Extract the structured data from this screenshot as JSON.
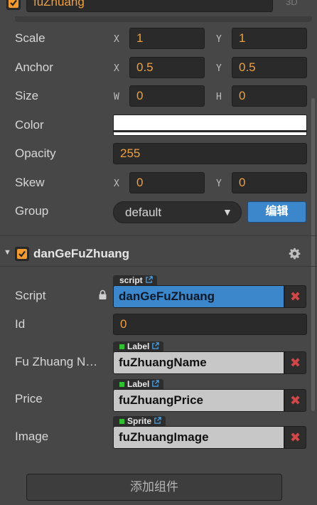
{
  "node": {
    "name": "fuZhuang",
    "badge_3d": "3D"
  },
  "props": {
    "scale": {
      "label": "Scale",
      "axis1": "X",
      "val1": "1",
      "axis2": "Y",
      "val2": "1"
    },
    "anchor": {
      "label": "Anchor",
      "axis1": "X",
      "val1": "0.5",
      "axis2": "Y",
      "val2": "0.5"
    },
    "size": {
      "label": "Size",
      "axis1": "W",
      "val1": "0",
      "axis2": "H",
      "val2": "0"
    },
    "color": {
      "label": "Color",
      "value": "#ffffff"
    },
    "opacity": {
      "label": "Opacity",
      "value": "255"
    },
    "skew": {
      "label": "Skew",
      "axis1": "X",
      "val1": "0",
      "axis2": "Y",
      "val2": "0"
    },
    "group": {
      "label": "Group",
      "value": "default",
      "edit_label": "编辑"
    }
  },
  "component": {
    "title": "danGeFuZhuang",
    "script": {
      "label": "Script",
      "tag": "script",
      "value": "danGeFuZhuang"
    },
    "id": {
      "label": "Id",
      "value": "0"
    },
    "fields": [
      {
        "label": "Fu Zhuang N…",
        "tag": "Label",
        "value": "fuZhuangName"
      },
      {
        "label": "Price",
        "tag": "Label",
        "value": "fuZhuangPrice"
      },
      {
        "label": "Image",
        "tag": "Sprite",
        "value": "fuZhuangImage"
      }
    ]
  },
  "add_component_label": "添加组件",
  "colors": {
    "background": "#474747",
    "accent_orange": "#f0a040",
    "checkbox_orange": "#f59a2e",
    "button_blue": "#3c87cc",
    "delete_red": "#d04848"
  }
}
